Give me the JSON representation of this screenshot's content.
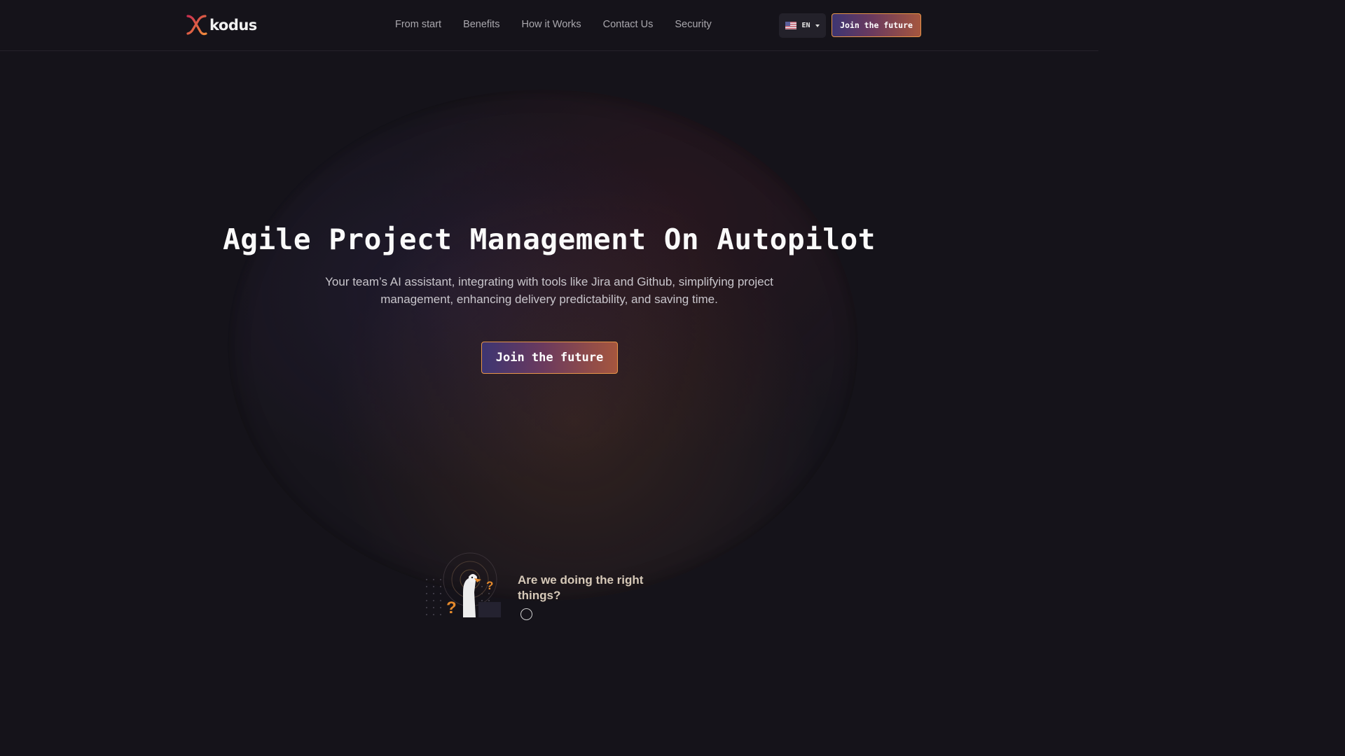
{
  "brand": {
    "name": "kodus"
  },
  "nav": {
    "items": [
      {
        "label": "From start"
      },
      {
        "label": "Benefits"
      },
      {
        "label": "How it Works"
      },
      {
        "label": "Contact Us"
      },
      {
        "label": "Security"
      }
    ]
  },
  "language": {
    "code": "EN",
    "flag": "us-flag-icon"
  },
  "header": {
    "cta_label": "Join the future"
  },
  "hero": {
    "title": "Agile Project Management On Autopilot",
    "subtitle": "Your team’s AI assistant, integrating with tools like Jira and Github, simplifying project management, enhancing delivery predictability, and saving time.",
    "cta_label": "Join the future"
  },
  "feature": {
    "title": "Are we doing the right things?"
  },
  "colors": {
    "background": "#15131a",
    "accent_orange": "#e7954a",
    "accent_purple": "#3d3572",
    "logo_red": "#d2344b"
  }
}
